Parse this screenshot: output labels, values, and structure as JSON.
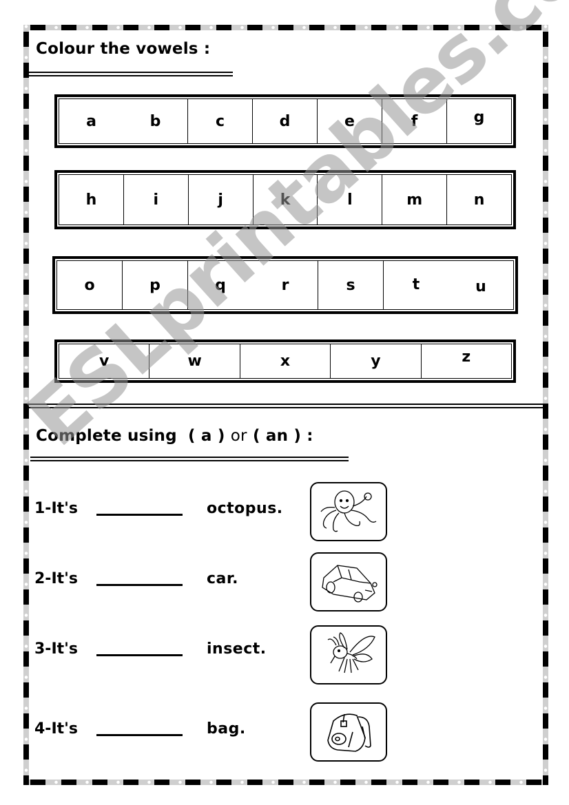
{
  "section1": {
    "title": "Colour the vowels :",
    "rows": [
      [
        "a",
        "b",
        "c",
        "d",
        "e",
        "f",
        "g"
      ],
      [
        "h",
        "i",
        "j",
        "k",
        "l",
        "m",
        "n"
      ],
      [
        "o",
        "p",
        "q",
        "r",
        "s",
        "t",
        "u"
      ],
      [
        "v",
        "w",
        "x",
        "y",
        "z"
      ]
    ]
  },
  "section2": {
    "title_part1": "Complete using",
    "title_a": "( a )",
    "title_or": "or",
    "title_an": "( an ) :",
    "items": [
      {
        "number": "1-It's",
        "word": "octopus.",
        "picture": "octopus-picture"
      },
      {
        "number": "2-It's",
        "word": "car.",
        "picture": "car-picture"
      },
      {
        "number": "3-It's",
        "word": "insect.",
        "picture": "insect-picture"
      },
      {
        "number": "4-It's",
        "word": "bag.",
        "picture": "bag-picture"
      }
    ]
  },
  "watermark": "ESLprintables.com"
}
